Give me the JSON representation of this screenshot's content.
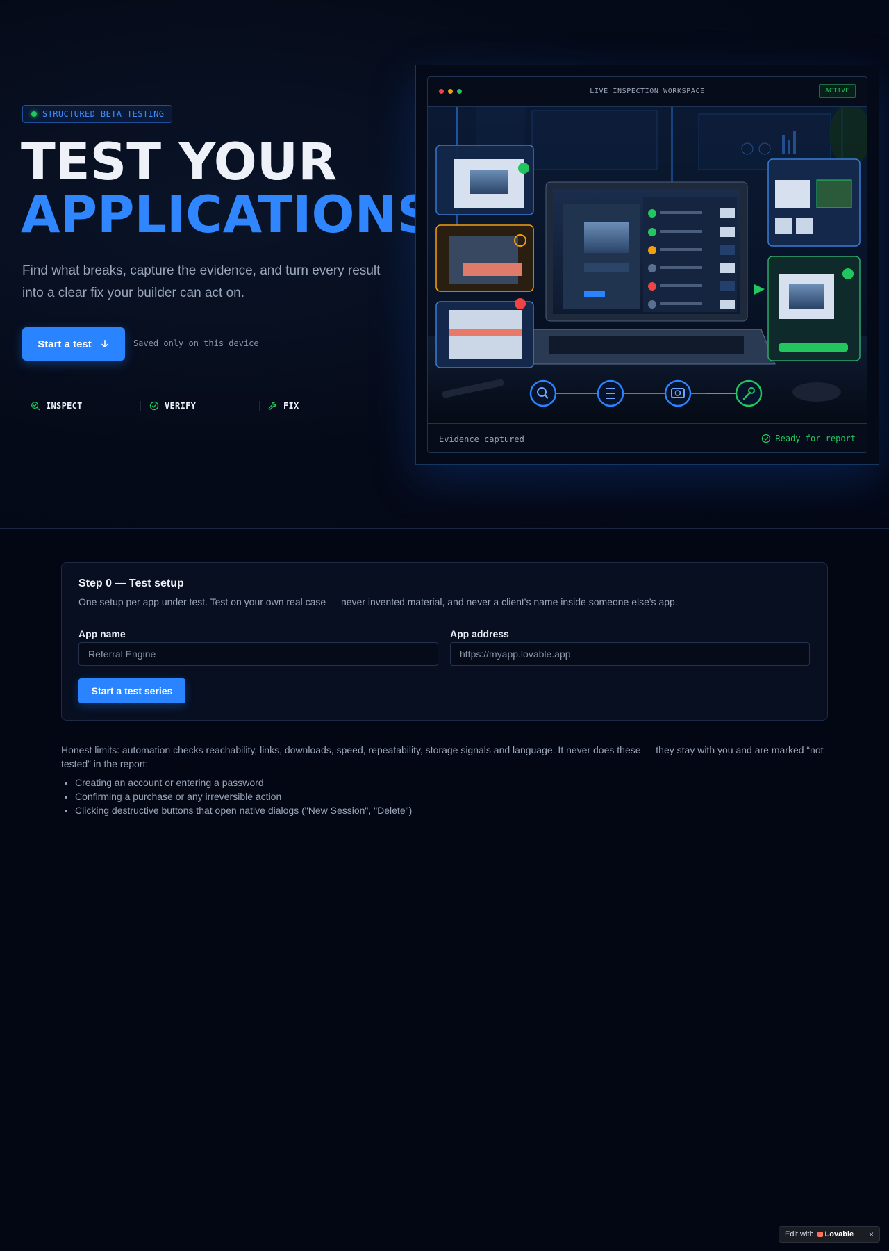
{
  "hero": {
    "badge": "STRUCTURED BETA TESTING",
    "title_line1": "TEST YOUR",
    "title_line2": "APPLICATIONS",
    "lede": "Find what breaks, capture the evidence, and turn every result into a clear fix your builder can act on.",
    "cta_label": "Start a test",
    "saved_note": "Saved only on this device",
    "pillars": [
      {
        "label": "INSPECT",
        "icon": "search-check-icon"
      },
      {
        "label": "VERIFY",
        "icon": "check-circle-icon"
      },
      {
        "label": "FIX",
        "icon": "wrench-icon"
      }
    ]
  },
  "workspace": {
    "title": "LIVE INSPECTION WORKSPACE",
    "status": "ACTIVE",
    "footer_left": "Evidence captured",
    "footer_right": "Ready for report"
  },
  "setup": {
    "title": "Step 0 — Test setup",
    "subtitle": "One setup per app under test. Test on your own real case — never invented material, and never a client's name inside someone else's app.",
    "app_name_label": "App name",
    "app_name_placeholder": "Referral Engine",
    "app_address_label": "App address",
    "app_address_placeholder": "https://myapp.lovable.app",
    "submit_label": "Start a test series"
  },
  "limits": {
    "intro": "Honest limits: automation checks reachability, links, downloads, speed, repeatability, storage signals and language. It never does these — they stay with you and are marked “not tested” in the report:",
    "items": [
      "Creating an account or entering a password",
      "Confirming a purchase or any irreversible action",
      "Clicking destructive buttons that open native dialogs (\"New Session\", \"Delete\")"
    ]
  },
  "lovable_badge": {
    "prefix": "Edit with",
    "brand": "Lovable",
    "close": "×"
  },
  "colors": {
    "accent": "#2a84ff",
    "success": "#22c55e",
    "warning": "#f59e0b",
    "danger": "#ef4444",
    "background": "#030713"
  }
}
